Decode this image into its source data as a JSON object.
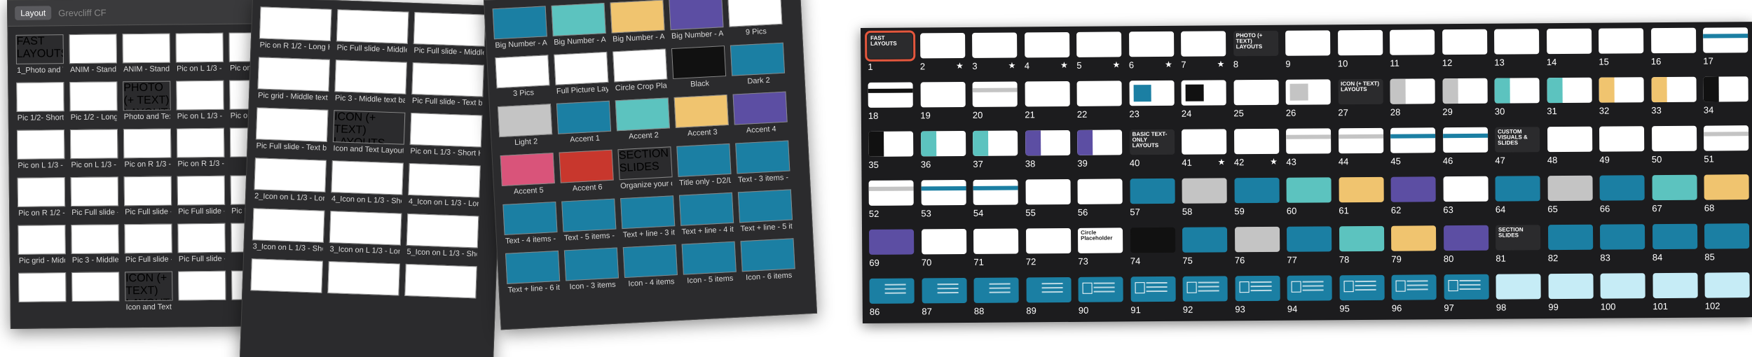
{
  "colors": {
    "panel_bg": "#2b2b2d",
    "teal": "#1b7fa3",
    "aqua": "#5cc3bf",
    "gold": "#f0c46f",
    "purple": "#5c4ea3",
    "gray": "#c4c4c4",
    "black": "#111111",
    "red": "#c8372d",
    "pink": "#d9547a",
    "sky": "#c6ecf6",
    "selection": "#e4573d"
  },
  "panel_a": {
    "toolbar": {
      "layout_button": "Layout",
      "font": "Grevcliff CF",
      "size": "30"
    },
    "cells": [
      {
        "caption": "1_Photo and Text Layouts >>",
        "badge": "FAST LAYOUTS",
        "kind": "badge"
      },
      {
        "caption": "ANIM - Standard Text (Short Title)",
        "kind": "plain"
      },
      {
        "caption": "ANIM - Standard Text (Long Title)",
        "kind": "plain"
      },
      {
        "caption": "Pic on L 1/3 - Short Headline - ANIM",
        "kind": "plain"
      },
      {
        "caption": "Pic on L 1/3 - Headline - AN",
        "kind": "plain"
      },
      {
        "caption": "Pic 1/2- Short Headline - ANIM",
        "kind": "plain"
      },
      {
        "caption": "Pic 1/2 - Long Headline - ANIM",
        "kind": "plain"
      },
      {
        "caption": "Photo and Text Layouts...",
        "badge": "PHOTO (+ TEXT) LAYOUTS",
        "kind": "badge"
      },
      {
        "caption": "Pic on L 1/3 - Short Headline",
        "kind": "plain"
      },
      {
        "caption": "Pic on L 1/3 - Long Headline",
        "kind": "plain"
      },
      {
        "caption": "Pic on L 1/3 - Short Headline",
        "kind": "plain"
      },
      {
        "caption": "Pic on L 1/3 - Long Headline",
        "kind": "plain"
      },
      {
        "caption": "Pic on R 1/3 - Short Headline",
        "kind": "plain"
      },
      {
        "caption": "Pic on R 1/3 - Long Headline",
        "kind": "plain"
      },
      {
        "caption": "",
        "kind": "plain"
      },
      {
        "caption": "Pic on R 1/2 - Long Headline",
        "kind": "plain"
      },
      {
        "caption": "Pic Full slide - Middle text bar - D1/1",
        "kind": "teal-bar"
      },
      {
        "caption": "Pic Full slide - Middle Color text bar - D1/1",
        "kind": "black-bar"
      },
      {
        "caption": "Pic Full slide - Middle Color text bar - L1/D2",
        "kind": "plain"
      },
      {
        "caption": "Pic Full slide - Middle Color text bar",
        "kind": "plain"
      },
      {
        "caption": "Pic grid - Middle text bar - L2/D1",
        "kind": "plain"
      },
      {
        "caption": "Pic 3 - Middle text bar - L2/D1",
        "kind": "plain"
      },
      {
        "caption": "Pic Full slide - Text block - D2/L1",
        "kind": "teal-block"
      },
      {
        "caption": "Pic Full slide - Text block - D1/L1",
        "kind": "black-block"
      },
      {
        "caption": "",
        "kind": "plain"
      },
      {
        "caption": "",
        "kind": "gray-box"
      },
      {
        "caption": "",
        "kind": "plain"
      },
      {
        "caption": "Icon and Text Layouts",
        "badge": "ICON (+ TEXT) LAYOUTS",
        "kind": "badge"
      },
      {
        "caption": "",
        "kind": "plain"
      },
      {
        "caption": "",
        "kind": "plain"
      }
    ]
  },
  "panel_b": {
    "header_captions": [
      "Short Headline",
      "Long Headline",
      "Short Headline"
    ],
    "cells": [
      {
        "caption": "Pic on R 1/2 - Long Headline",
        "kind": "plain"
      },
      {
        "caption": "Pic Full slide - Middle text bar - D2/L1",
        "kind": "teal-bar"
      },
      {
        "caption": "Pic Full slide - Middle Color text bar - D1/L1",
        "kind": "black-bar"
      },
      {
        "caption": "Pic grid - Middle text bar - L2/D1",
        "kind": "plain"
      },
      {
        "caption": "Pic 3 - Middle text bar - L2/D1",
        "kind": "plain"
      },
      {
        "caption": "Pic Full slide - Text block - D2/L1",
        "kind": "teal-block"
      },
      {
        "caption": "Pic Full slide - Text block - L2/D1",
        "kind": "gray-box"
      },
      {
        "caption": "Icon and Text Layouts >>",
        "badge": "ICON (+ TEXT) LAYOUTS",
        "kind": "badge"
      },
      {
        "caption": "Pic on L 1/3 - Short Headline",
        "kind": "plain"
      },
      {
        "caption": "2_Icon on L 1/3 - Long Headline",
        "kind": "aqua-left"
      },
      {
        "caption": "4_Icon on L 1/3 - Short Headline",
        "kind": "gold-left"
      },
      {
        "caption": "4_Icon on L 1/3 - Long Headline",
        "kind": "gold-left"
      },
      {
        "caption": "3_Icon on L 1/3 - Short Headline",
        "kind": "aqua-left"
      },
      {
        "caption": "3_Icon on L 1/3 - Long Headline",
        "kind": "aqua-left"
      },
      {
        "caption": "5_Icon on L 1/3 - Short Headline",
        "kind": "purple-left"
      },
      {
        "caption": "",
        "kind": "plain"
      },
      {
        "caption": "",
        "kind": "plain"
      },
      {
        "caption": "",
        "kind": "plain"
      }
    ]
  },
  "panel_c": {
    "cells": [
      {
        "caption": "Big Number - A1/D1",
        "kind": "teal"
      },
      {
        "caption": "Big Number - A2/D1",
        "kind": "aqua"
      },
      {
        "caption": "Big Number - A3/D1",
        "kind": "gold"
      },
      {
        "caption": "Big Number - A4/L1",
        "kind": "purple"
      },
      {
        "caption": "9 Pics",
        "kind": "plain"
      },
      {
        "caption": "3 Pics",
        "kind": "plain"
      },
      {
        "caption": "Full Picture Layout",
        "kind": "plain"
      },
      {
        "caption": "Circle Crop Placeholder",
        "kind": "plain"
      },
      {
        "caption": "Black",
        "kind": "black"
      },
      {
        "caption": "Dark 2",
        "kind": "teal"
      },
      {
        "caption": "Light 2",
        "kind": "gray"
      },
      {
        "caption": "Accent 1",
        "kind": "teal"
      },
      {
        "caption": "Accent 2",
        "kind": "aqua"
      },
      {
        "caption": "Accent 3",
        "kind": "gold"
      },
      {
        "caption": "Accent 4",
        "kind": "purple"
      },
      {
        "caption": "Accent 5",
        "kind": "pink"
      },
      {
        "caption": "Accent 6",
        "kind": "red"
      },
      {
        "caption": "Organize your deck >>",
        "badge": "SECTION SLIDES",
        "kind": "badge"
      },
      {
        "caption": "Title only - D2/L1",
        "kind": "teal"
      },
      {
        "caption": "Text - 3 items - D2/L1",
        "kind": "teal-lines"
      },
      {
        "caption": "Text - 4 items - D2/L1",
        "kind": "teal-lines"
      },
      {
        "caption": "Text - 5 items - D2/L1",
        "kind": "teal-lines"
      },
      {
        "caption": "Text + line - 3 items - D2/L1",
        "kind": "teal-lines"
      },
      {
        "caption": "Text + line - 4 items - D2/L1",
        "kind": "teal-lines"
      },
      {
        "caption": "Text + line - 5 items - D2/L1",
        "kind": "teal-lines"
      },
      {
        "caption": "Text + line - 6 items",
        "kind": "teal-lines"
      },
      {
        "caption": "Icon - 3 items",
        "kind": "teal-icon"
      },
      {
        "caption": "Icon - 4 items",
        "kind": "teal-icon"
      },
      {
        "caption": "Icon - 5 items",
        "kind": "teal-icon"
      },
      {
        "caption": "Icon - 6 items",
        "kind": "teal-icon"
      }
    ]
  },
  "navigator": {
    "slides": [
      {
        "n": "1",
        "kind": "badge",
        "badge": "FAST LAYOUTS",
        "selected": true
      },
      {
        "n": "2",
        "kind": "plain",
        "star": true
      },
      {
        "n": "3",
        "kind": "plain",
        "star": true
      },
      {
        "n": "4",
        "kind": "plain",
        "star": true
      },
      {
        "n": "5",
        "kind": "plain",
        "star": true
      },
      {
        "n": "6",
        "kind": "plain",
        "star": true
      },
      {
        "n": "7",
        "kind": "plain",
        "star": true
      },
      {
        "n": "8",
        "kind": "badge",
        "badge": "PHOTO (+ TEXT) LAYOUTS"
      },
      {
        "n": "9",
        "kind": "plain"
      },
      {
        "n": "10",
        "kind": "plain"
      },
      {
        "n": "11",
        "kind": "plain"
      },
      {
        "n": "12",
        "kind": "plain"
      },
      {
        "n": "13",
        "kind": "plain"
      },
      {
        "n": "14",
        "kind": "plain"
      },
      {
        "n": "15",
        "kind": "plain"
      },
      {
        "n": "16",
        "kind": "plain"
      },
      {
        "n": "17",
        "kind": "teal-bar"
      },
      {
        "n": "18",
        "kind": "black-bar"
      },
      {
        "n": "19",
        "kind": "plain"
      },
      {
        "n": "20",
        "kind": "gray-bar"
      },
      {
        "n": "21",
        "kind": "plain"
      },
      {
        "n": "22",
        "kind": "plain"
      },
      {
        "n": "23",
        "kind": "teal-box"
      },
      {
        "n": "24",
        "kind": "black-box"
      },
      {
        "n": "25",
        "kind": "plain"
      },
      {
        "n": "26",
        "kind": "gray-box"
      },
      {
        "n": "27",
        "kind": "badge",
        "badge": "ICON (+ TEXT) LAYOUTS"
      },
      {
        "n": "28",
        "kind": "gray-left"
      },
      {
        "n": "29",
        "kind": "gray-left"
      },
      {
        "n": "30",
        "kind": "aqua-left"
      },
      {
        "n": "31",
        "kind": "aqua-left"
      },
      {
        "n": "32",
        "kind": "gold-left"
      },
      {
        "n": "33",
        "kind": "gold-left"
      },
      {
        "n": "34",
        "kind": "black-left"
      },
      {
        "n": "35",
        "kind": "black-left"
      },
      {
        "n": "36",
        "kind": "aqua-left"
      },
      {
        "n": "37",
        "kind": "aqua-left"
      },
      {
        "n": "38",
        "kind": "purple-left"
      },
      {
        "n": "39",
        "kind": "purple-left"
      },
      {
        "n": "40",
        "kind": "badge",
        "badge": "BASIC TEXT-ONLY LAYOUTS"
      },
      {
        "n": "41",
        "kind": "plain",
        "star": true
      },
      {
        "n": "42",
        "kind": "plain",
        "star": true
      },
      {
        "n": "43",
        "kind": "gray-bar"
      },
      {
        "n": "44",
        "kind": "gray-bar"
      },
      {
        "n": "45",
        "kind": "teal-bar"
      },
      {
        "n": "46",
        "kind": "teal-bar"
      },
      {
        "n": "47",
        "kind": "badge",
        "badge": "CUSTOM VISUALS & SLIDES"
      },
      {
        "n": "48",
        "kind": "plain"
      },
      {
        "n": "49",
        "kind": "plain"
      },
      {
        "n": "50",
        "kind": "plain"
      },
      {
        "n": "51",
        "kind": "gray-bar"
      },
      {
        "n": "52",
        "kind": "gray-bar"
      },
      {
        "n": "53",
        "kind": "teal-bar"
      },
      {
        "n": "54",
        "kind": "teal-bar"
      },
      {
        "n": "55",
        "kind": "plain"
      },
      {
        "n": "56",
        "kind": "plain"
      },
      {
        "n": "57",
        "kind": "teal"
      },
      {
        "n": "58",
        "kind": "gray"
      },
      {
        "n": "59",
        "kind": "teal"
      },
      {
        "n": "60",
        "kind": "aqua"
      },
      {
        "n": "61",
        "kind": "gold"
      },
      {
        "n": "62",
        "kind": "purple"
      },
      {
        "n": "63",
        "kind": "plain"
      },
      {
        "n": "64",
        "kind": "teal"
      },
      {
        "n": "65",
        "kind": "gray"
      },
      {
        "n": "66",
        "kind": "teal"
      },
      {
        "n": "67",
        "kind": "aqua"
      },
      {
        "n": "68",
        "kind": "gold"
      },
      {
        "n": "69",
        "kind": "purple"
      },
      {
        "n": "70",
        "kind": "plain"
      },
      {
        "n": "71",
        "kind": "plain"
      },
      {
        "n": "72",
        "kind": "plain"
      },
      {
        "n": "73",
        "kind": "circle",
        "badge": "Circle Placeholder"
      },
      {
        "n": "74",
        "kind": "black"
      },
      {
        "n": "75",
        "kind": "teal"
      },
      {
        "n": "76",
        "kind": "gray"
      },
      {
        "n": "77",
        "kind": "teal"
      },
      {
        "n": "78",
        "kind": "aqua"
      },
      {
        "n": "79",
        "kind": "gold"
      },
      {
        "n": "80",
        "kind": "purple"
      },
      {
        "n": "81",
        "kind": "badge",
        "badge": "SECTION SLIDES"
      },
      {
        "n": "82",
        "kind": "teal"
      },
      {
        "n": "83",
        "kind": "teal"
      },
      {
        "n": "84",
        "kind": "teal"
      },
      {
        "n": "85",
        "kind": "teal"
      },
      {
        "n": "86",
        "kind": "teal-lines"
      },
      {
        "n": "87",
        "kind": "teal-lines"
      },
      {
        "n": "88",
        "kind": "teal-lines"
      },
      {
        "n": "89",
        "kind": "teal-lines"
      },
      {
        "n": "90",
        "kind": "teal-icon"
      },
      {
        "n": "91",
        "kind": "teal-icon"
      },
      {
        "n": "92",
        "kind": "teal-icon"
      },
      {
        "n": "93",
        "kind": "teal-icon"
      },
      {
        "n": "94",
        "kind": "teal-icon"
      },
      {
        "n": "95",
        "kind": "teal-icon"
      },
      {
        "n": "96",
        "kind": "teal-icon"
      },
      {
        "n": "97",
        "kind": "teal-icon"
      },
      {
        "n": "98",
        "kind": "sky"
      },
      {
        "n": "99",
        "kind": "sky"
      },
      {
        "n": "100",
        "kind": "sky"
      },
      {
        "n": "101",
        "kind": "sky"
      },
      {
        "n": "102",
        "kind": "sky"
      }
    ],
    "star_glyph": "★"
  }
}
